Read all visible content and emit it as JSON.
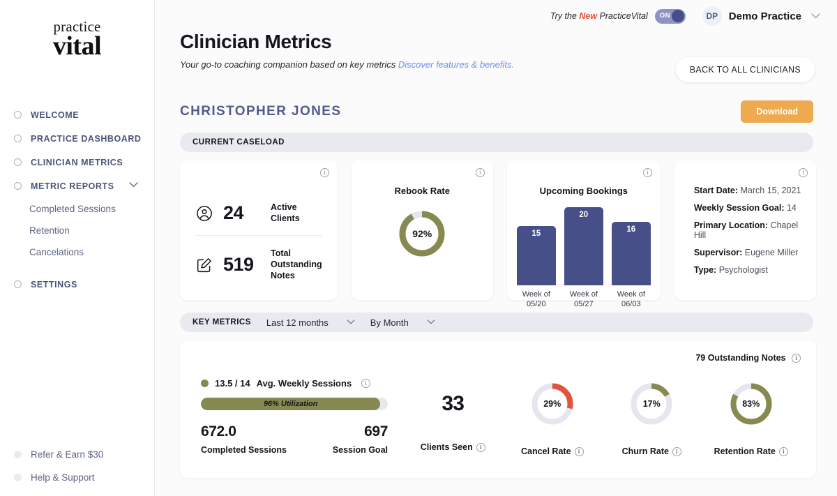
{
  "sidebar": {
    "logo": {
      "line1": "practice",
      "line2": "vital"
    },
    "items": [
      {
        "label": "WELCOME",
        "icon": "circle-icon"
      },
      {
        "label": "PRACTICE DASHBOARD",
        "icon": "circle-icon"
      },
      {
        "label": "CLINICIAN METRICS",
        "icon": "circle-icon"
      },
      {
        "label": "METRIC REPORTS",
        "icon": "circle-icon",
        "chevron": "chevron-down-icon"
      }
    ],
    "sub_items": [
      {
        "label": "Completed Sessions"
      },
      {
        "label": "Retention"
      },
      {
        "label": "Cancelations"
      }
    ],
    "settings": {
      "label": "SETTINGS",
      "icon": "circle-icon"
    },
    "bottom_items": [
      {
        "label": "Refer & Earn $30"
      },
      {
        "label": "Help & Support"
      }
    ]
  },
  "topbar": {
    "try_prefix": "Try the ",
    "try_new": "New",
    "try_suffix": " PracticeVital",
    "toggle_state": "ON",
    "avatar_initials": "DP",
    "practice_name": "Demo Practice",
    "caret": "⌄"
  },
  "header": {
    "title": "Clinician Metrics",
    "subtitle": "Your go-to coaching companion based on key metrics ",
    "subtitle_link": "Discover features & benefits.",
    "back_button": "BACK TO ALL CLINICIANS"
  },
  "clinician": {
    "name": "CHRISTOPHER JONES",
    "download_label": "Download"
  },
  "sections": {
    "current_caseload": "CURRENT CASELOAD",
    "key_metrics": "KEY METRICS"
  },
  "filters": {
    "range": "Last 12 months",
    "grouping": "By Month",
    "chevron": "⌄"
  },
  "caseload": {
    "clients_card": {
      "active_clients_value": "24",
      "active_clients_label": "Active Clients",
      "active_clients_icon": "user-circle-icon",
      "notes_value": "519",
      "notes_label": "Total Outstanding Notes",
      "notes_icon": "note-edit-icon",
      "info_icon": "info-icon"
    },
    "rebook_card": {
      "title": "Rebook Rate",
      "value": "92%",
      "info_icon": "info-icon"
    },
    "bookings_card": {
      "title": "Upcoming Bookings",
      "info_icon": "info-icon"
    },
    "details_card": {
      "info_icon": "info-icon",
      "rows": [
        {
          "label": "Start Date:",
          "value": "March 15, 2021"
        },
        {
          "label": "Weekly Session Goal:",
          "value": "14"
        },
        {
          "label": "Primary Location:",
          "value": "Chapel Hill"
        },
        {
          "label": "Supervisor:",
          "value": "Eugene Miller"
        },
        {
          "label": "Type:",
          "value": "Psychologist"
        }
      ]
    }
  },
  "key_metrics": {
    "outstanding_notes": "79 Outstanding Notes",
    "avg_weekly_sessions_value": "13.5 / 14",
    "avg_weekly_sessions_label": "Avg. Weekly Sessions",
    "utilization_text": "96% Utilization",
    "completed_sessions_value": "672.0",
    "completed_sessions_label": "Completed Sessions",
    "session_goal_value": "697",
    "session_goal_label": "Session Goal",
    "clients_seen_value": "33",
    "clients_seen_label": "Clients Seen",
    "cancel_rate_value": "29%",
    "cancel_rate_label": "Cancel Rate",
    "churn_rate_value": "17%",
    "churn_rate_label": "Churn Rate",
    "retention_rate_value": "83%",
    "retention_rate_label": "Retention Rate",
    "info_icon": "info-icon"
  },
  "colors": {
    "olive": "#868a50",
    "navy": "#474f88",
    "orange_accent": "#efa94f",
    "red": "#e0543c",
    "track": "#e5e6ef",
    "link_blue": "#6b8fe8",
    "new_red": "#e8503a"
  },
  "chart_data": [
    {
      "type": "bar",
      "title": "Upcoming Bookings",
      "categories": [
        "Week of 05/20",
        "Week of 05/27",
        "Week of 06/03"
      ],
      "values": [
        15,
        20,
        16
      ],
      "xlabel": "",
      "ylabel": "",
      "ylim": [
        0,
        20
      ],
      "grid": false,
      "legend": "none",
      "color": "#474f88"
    },
    {
      "type": "pie",
      "title": "Rebook Rate",
      "categories": [
        "Rebooked",
        "Remaining"
      ],
      "values": [
        92,
        8
      ],
      "value_label": "92%",
      "colors": [
        "#868a50",
        "#e5e6ef"
      ]
    },
    {
      "type": "pie",
      "title": "Cancel Rate",
      "categories": [
        "Canceled",
        "Remaining"
      ],
      "values": [
        29,
        71
      ],
      "value_label": "29%",
      "colors": [
        "#e0543c",
        "#e5e6ef"
      ]
    },
    {
      "type": "pie",
      "title": "Churn Rate",
      "categories": [
        "Churned",
        "Remaining"
      ],
      "values": [
        17,
        83
      ],
      "value_label": "17%",
      "colors": [
        "#868a50",
        "#e5e6ef"
      ]
    },
    {
      "type": "pie",
      "title": "Retention Rate",
      "categories": [
        "Retained",
        "Remaining"
      ],
      "values": [
        83,
        17
      ],
      "value_label": "83%",
      "colors": [
        "#868a50",
        "#e5e6ef"
      ]
    },
    {
      "type": "bar",
      "title": "96% Utilization",
      "categories": [
        "Utilization"
      ],
      "values": [
        96
      ],
      "ylim": [
        0,
        100
      ],
      "color": "#868a50"
    }
  ]
}
